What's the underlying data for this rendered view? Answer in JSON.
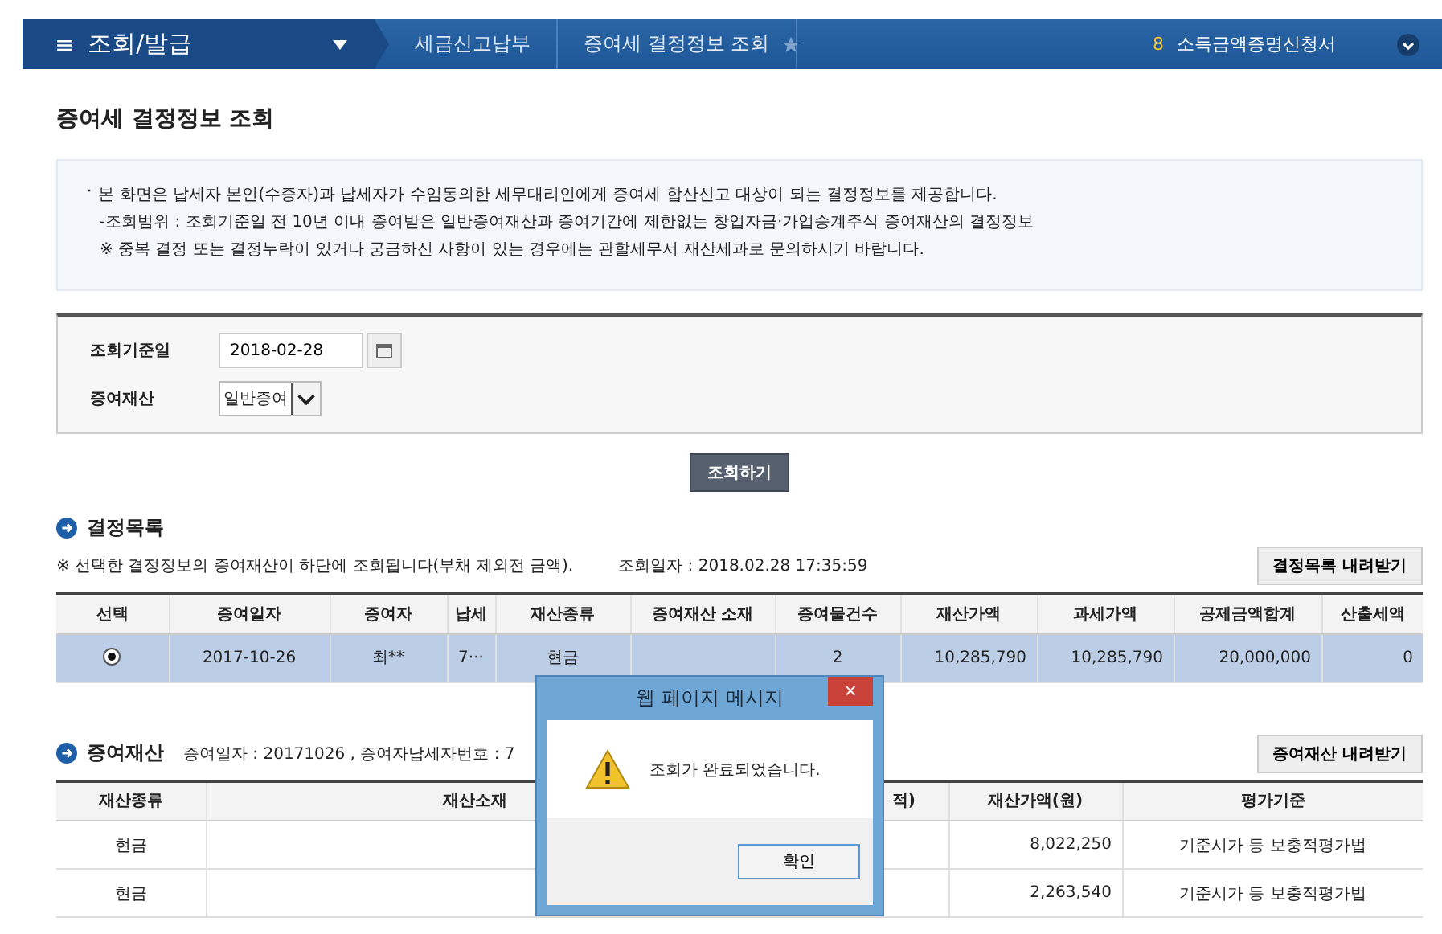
{
  "nav": {
    "menu_icon": "≡",
    "menu": "조회/발급",
    "crumbs": [
      {
        "label": "세금신고납부"
      },
      {
        "label": "증여세 결정정보 조회"
      }
    ],
    "favorite": false,
    "shortcut_num": "8",
    "shortcut": "소득금액증명신청서"
  },
  "page_title": "증여세 결정정보 조회",
  "notice_bullet": "·",
  "notice": [
    "본 화면은 납세자 본인(수증자)과 납세자가 수임동의한 세무대리인에게 증여세 합산신고 대상이 되는 결정정보를 제공합니다.",
    "-조회범위 : 조회기준일 전 10년 이내 증여받은 일반증여재산과 증여기간에 제한없는 창업자금·가업승계주식 증여재산의 결정정보",
    "※ 중복 결정 또는 결정누락이 있거나 궁금하신 사항이 있는 경우에는 관할세무서 재산세과로 문의하시기 바랍니다."
  ],
  "search": {
    "date_label": "조회기준일",
    "date_value": "2018-02-28",
    "type_label": "증여재산",
    "type_value": "일반증여",
    "button": "조회하기"
  },
  "decisions": {
    "title": "결정목록",
    "note": "※ 선택한 결정정보의 증여재산이 하단에 조회됩니다(부채 제외전 금액).",
    "query_time": "조회일자 : 2018.02.28 17:35:59",
    "download": "결정목록 내려받기",
    "columns": [
      "선택",
      "증여일자",
      "증여자",
      "납세",
      "재산종류",
      "증여재산 소재",
      "증여물건수",
      "재산가액",
      "과세가액",
      "공제금액합계",
      "산출세액"
    ],
    "rows": [
      {
        "selected": true,
        "cells": [
          "",
          "2017-10-26",
          "최**",
          "7···",
          "현금",
          "",
          "2",
          "10,285,790",
          "10,285,790",
          "20,000,000",
          "0"
        ]
      }
    ]
  },
  "assets": {
    "title": "증여재산",
    "info": "증여일자 : 20171026 , 증여자납세자번호 : 7",
    "download": "증여재산 내려받기",
    "columns": [
      "재산종류",
      "재산소재",
      "적)",
      "재산가액(원)",
      "평가기준"
    ],
    "rows": [
      [
        "현금",
        "",
        "",
        "8,022,250",
        "기준시가 등 보충적평가법"
      ],
      [
        "현금",
        "",
        "",
        "2,263,540",
        "기준시가 등 보충적평가법"
      ]
    ]
  },
  "dialog": {
    "title": "웹 페이지 메시지",
    "close": "×",
    "message": "조회가 완료되었습니다.",
    "button": "확인"
  }
}
